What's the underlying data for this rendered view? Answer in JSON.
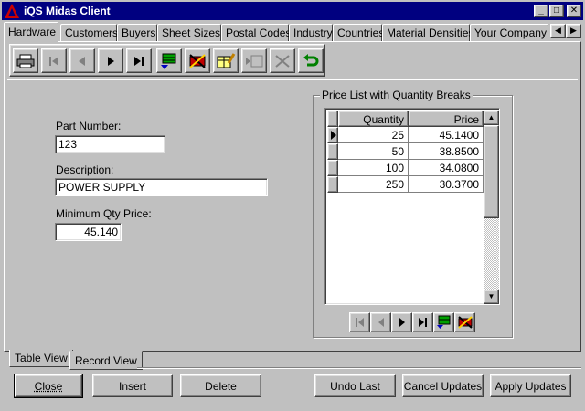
{
  "window": {
    "title": "iQS Midas Client",
    "controls": {
      "minimize": "_",
      "maximize": "□",
      "close": "✕"
    }
  },
  "top_tabs": [
    "Hardware",
    "Customers",
    "Buyers",
    "Sheet Sizes",
    "Postal Codes",
    "Industry",
    "Countries",
    "Material Densities",
    "Your Company"
  ],
  "active_tab": "Hardware",
  "toolbar": {
    "icons": [
      "printer-icon",
      "first-record-icon",
      "previous-record-icon",
      "next-record-icon",
      "last-record-icon",
      "insert-record-icon",
      "delete-record-icon",
      "edit-record-icon",
      "post-record-icon",
      "cancel-edit-icon",
      "refresh-icon"
    ]
  },
  "form": {
    "part_number_label": "Part Number:",
    "part_number_value": "123",
    "description_label": "Description:",
    "description_value": "POWER SUPPLY",
    "min_qty_price_label": "Minimum Qty Price:",
    "min_qty_price_value": "45.140"
  },
  "price_list": {
    "title": "Price List with Quantity Breaks",
    "columns": [
      "Quantity",
      "Price"
    ],
    "rows": [
      {
        "quantity": "25",
        "price": "45.1400"
      },
      {
        "quantity": "50",
        "price": "38.8500"
      },
      {
        "quantity": "100",
        "price": "34.0800"
      },
      {
        "quantity": "250",
        "price": "30.3700"
      }
    ],
    "current_row": 0
  },
  "view_tabs": [
    "Table View",
    "Record View"
  ],
  "active_view_tab": "Record View",
  "buttons": {
    "close": "Close",
    "insert": "Insert",
    "delete": "Delete",
    "undo_last": "Undo Last",
    "cancel_updates": "Cancel Updates",
    "apply_updates": "Apply Updates"
  },
  "colors": {
    "title_bar": "#000080",
    "face": "#c0c0c0",
    "logo": "#cc0000"
  }
}
